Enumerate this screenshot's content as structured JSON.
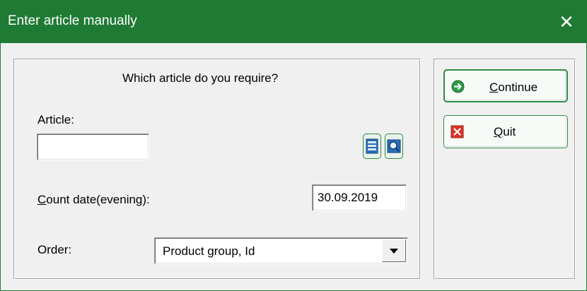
{
  "window": {
    "title": "Enter article manually",
    "close_glyph": "✕"
  },
  "form": {
    "question": "Which article do you require?",
    "article_label": "Article:",
    "article_value": "",
    "count_label_mnemonic": "C",
    "count_label_rest": "ount date(evening):",
    "count_date": "30.09.2019",
    "order_label": "Order:",
    "order_value": "Product group, Id"
  },
  "buttons": {
    "continue_mnemonic": "C",
    "continue_rest": "ontinue",
    "quit_mnemonic": "Q",
    "quit_rest": "uit"
  },
  "icons": [
    "list-icon",
    "search-icon",
    "arrow-right-icon",
    "quit-x-icon",
    "chevron-down-icon"
  ],
  "colors": {
    "titlebar": "#1f7a34",
    "accent_green": "#2e8b43",
    "quit_red": "#d9352a"
  }
}
